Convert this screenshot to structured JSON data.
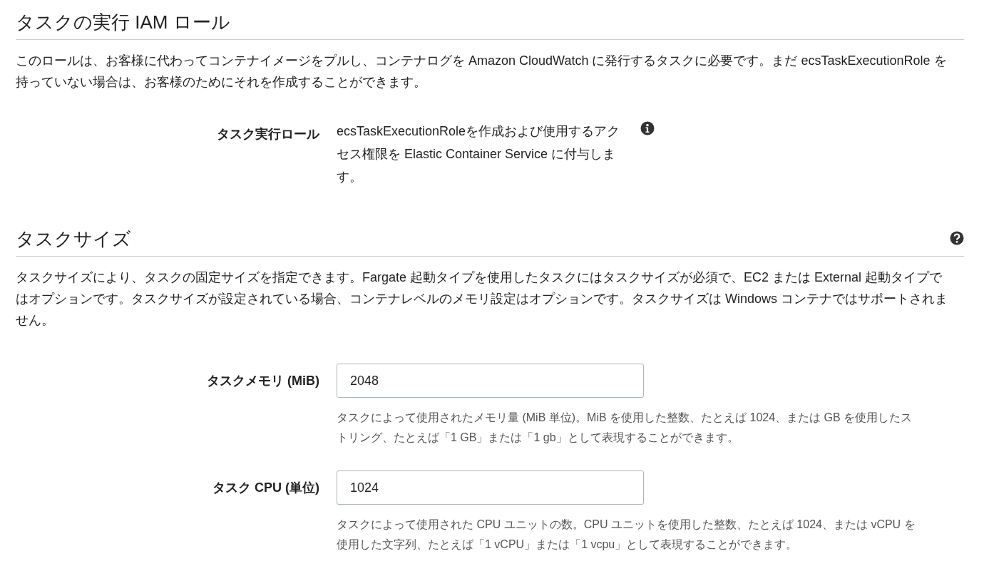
{
  "sections": [
    {
      "title": "タスクの実行 IAM ロール",
      "help_icon": false,
      "description": "このロールは、お客様に代わってコンテナイメージをプルし、コンテナログを Amazon CloudWatch に発行するタスクに必要です。まだ ecsTaskExecutionRole を持っていない場合は、お客様のためにそれを作成することができます。",
      "fields": [
        {
          "kind": "text",
          "label": "タスク実行ロール",
          "value": "ecsTaskExecutionRoleを作成および使用するアクセス権限を Elastic Container Service に付与します。",
          "info_icon": true
        }
      ]
    },
    {
      "title": "タスクサイズ",
      "help_icon": true,
      "description": "タスクサイズにより、タスクの固定サイズを指定できます。Fargate 起動タイプを使用したタスクにはタスクサイズが必須で、EC2 または External 起動タイプではオプションです。タスクサイズが設定されている場合、コンテナレベルのメモリ設定はオプションです。タスクサイズは Windows コンテナではサポートされません。",
      "fields": [
        {
          "kind": "input",
          "label": "タスクメモリ (MiB)",
          "value": "2048",
          "hint": "タスクによって使用されたメモリ量 (MiB 単位)。MiB を使用した整数、たとえば 1024、または GB を使用したストリング、たとえば「1 GB」または「1 gb」として表現することができます。"
        },
        {
          "kind": "input",
          "label": "タスク CPU (単位)",
          "value": "1024",
          "hint": "タスクによって使用された CPU ユニットの数。CPU ユニットを使用した整数、たとえば 1024、または vCPU を使用した文字列、たとえば「1 vCPU」または「1 vcpu」として表現することができます。"
        }
      ]
    }
  ]
}
